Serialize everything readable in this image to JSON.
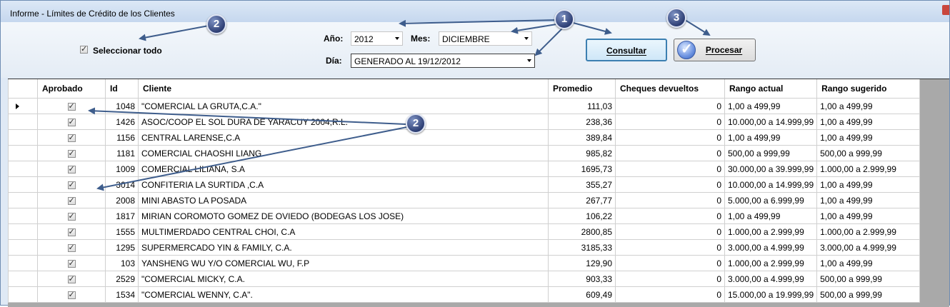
{
  "window": {
    "title": "Informe - Límites de Crédito de los Clientes"
  },
  "toolbar": {
    "select_all_label": "Seleccionar todo",
    "year_label": "Año:",
    "year_value": "2012",
    "month_label": "Mes:",
    "month_value": "DICIEMBRE",
    "day_label": "Día:",
    "day_value": "GENERADO AL 19/12/2012",
    "consultar_label": "Consultar",
    "procesar_label": "Procesar"
  },
  "callouts": {
    "one": "1",
    "two": "2",
    "three": "3"
  },
  "grid": {
    "columns": [
      "Aprobado",
      "Id",
      "Cliente",
      "Promedio",
      "Cheques devueltos",
      "Rango actual",
      "Rango sugerido"
    ],
    "rows": [
      {
        "id": "1048",
        "cliente": "\"COMERCIAL LA GRUTA,C.A.\"",
        "promedio": "111,03",
        "cheques": "0",
        "actual": "1,00 a 499,99",
        "sugerido": "1,00 a 499,99"
      },
      {
        "id": "1426",
        "cliente": "ASOC/COOP EL SOL DURA DE YARACUY 2004,R.L.",
        "promedio": "238,36",
        "cheques": "0",
        "actual": "10.000,00 a 14.999,99",
        "sugerido": "1,00 a 499,99"
      },
      {
        "id": "1156",
        "cliente": "CENTRAL LARENSE,C.A",
        "promedio": "389,84",
        "cheques": "0",
        "actual": "1,00 a 499,99",
        "sugerido": "1,00 a 499,99"
      },
      {
        "id": "1181",
        "cliente": "COMERCIAL CHAOSHI LIANG",
        "promedio": "985,82",
        "cheques": "0",
        "actual": "500,00 a 999,99",
        "sugerido": "500,00 a 999,99"
      },
      {
        "id": "1009",
        "cliente": "COMERCIAL LILIANA, S.A",
        "promedio": "1695,73",
        "cheques": "0",
        "actual": "30.000,00 a 39.999,99",
        "sugerido": "1.000,00 a 2.999,99"
      },
      {
        "id": "3014",
        "cliente": "CONFITERIA LA SURTIDA ,C.A",
        "promedio": "355,27",
        "cheques": "0",
        "actual": "10.000,00 a 14.999,99",
        "sugerido": "1,00 a 499,99"
      },
      {
        "id": "2008",
        "cliente": "MINI ABASTO LA POSADA",
        "promedio": "267,77",
        "cheques": "0",
        "actual": "5.000,00 a 6.999,99",
        "sugerido": "1,00 a 499,99"
      },
      {
        "id": "1817",
        "cliente": "MIRIAN COROMOTO GOMEZ DE OVIEDO (BODEGAS LOS JOSE)",
        "promedio": "106,22",
        "cheques": "0",
        "actual": "1,00 a 499,99",
        "sugerido": "1,00 a 499,99"
      },
      {
        "id": "1555",
        "cliente": "MULTIMERDADO CENTRAL CHOI, C.A",
        "promedio": "2800,85",
        "cheques": "0",
        "actual": "1.000,00 a 2.999,99",
        "sugerido": "1.000,00 a 2.999,99"
      },
      {
        "id": "1295",
        "cliente": "SUPERMERCADO YIN & FAMILY, C.A.",
        "promedio": "3185,33",
        "cheques": "0",
        "actual": "3.000,00 a 4.999,99",
        "sugerido": "3.000,00 a 4.999,99"
      },
      {
        "id": "103",
        "cliente": "YANSHENG WU Y/O COMERCIAL WU, F.P",
        "promedio": "129,90",
        "cheques": "0",
        "actual": "1.000,00 a 2.999,99",
        "sugerido": "1,00 a 499,99"
      },
      {
        "id": "2529",
        "cliente": "\"COMERCIAL MICKY, C.A.",
        "promedio": "903,33",
        "cheques": "0",
        "actual": "3.000,00 a 4.999,99",
        "sugerido": "500,00 a 999,99"
      },
      {
        "id": "1534",
        "cliente": "\"COMERCIAL WENNY, C.A\".",
        "promedio": "609,49",
        "cheques": "0",
        "actual": "15.000,00 a 19.999,99",
        "sugerido": "500,00 a 999,99"
      }
    ]
  }
}
